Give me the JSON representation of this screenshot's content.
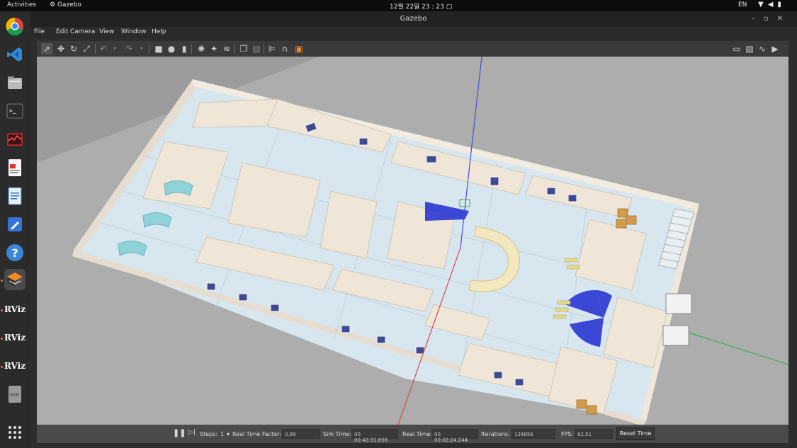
{
  "topbar": {
    "activities": "Activities",
    "app": "Gazebo",
    "clock": "12월 22일  23 : 23",
    "lang": "EN"
  },
  "window": {
    "title": "Gazebo",
    "menus": [
      "File",
      "Edit",
      "Camera",
      "View",
      "Window",
      "Help"
    ]
  },
  "dock": {
    "items": [
      "chrome-icon",
      "vscode-icon",
      "files-icon",
      "terminal-icon",
      "system-monitor-icon",
      "document-viewer-icon",
      "writer-icon",
      "text-editor-icon",
      "help-icon",
      "gazebo-icon",
      "rviz-icon",
      "rviz-icon",
      "rviz-icon",
      "ssd-drive-icon",
      "app-grid-icon"
    ],
    "labels": {
      "rviz": "RViz",
      "ssd": "SSD"
    }
  },
  "bottombar": {
    "steps_label": "Steps:",
    "steps_value": "1",
    "rtf_label": "Real Time Factor:",
    "rtf_value": "0.99",
    "sim_time_label": "Sim Time:",
    "sim_time_value": "00 00:42:31.856",
    "real_time_label": "Real Time:",
    "real_time_value": "00 00:02:24.244",
    "iterations_label": "Iterations:",
    "iterations_value": "134856",
    "fps_label": "FPS:",
    "fps_value": "62.51",
    "reset_label": "Reset Time"
  },
  "colors": {
    "floor": "#d8e6ef",
    "wall": "#efe8dc",
    "accent_blue": "#1f2bd0",
    "axis_x": "#d94a4a",
    "axis_y": "#3fae4d",
    "axis_z": "#4a4ad9"
  }
}
